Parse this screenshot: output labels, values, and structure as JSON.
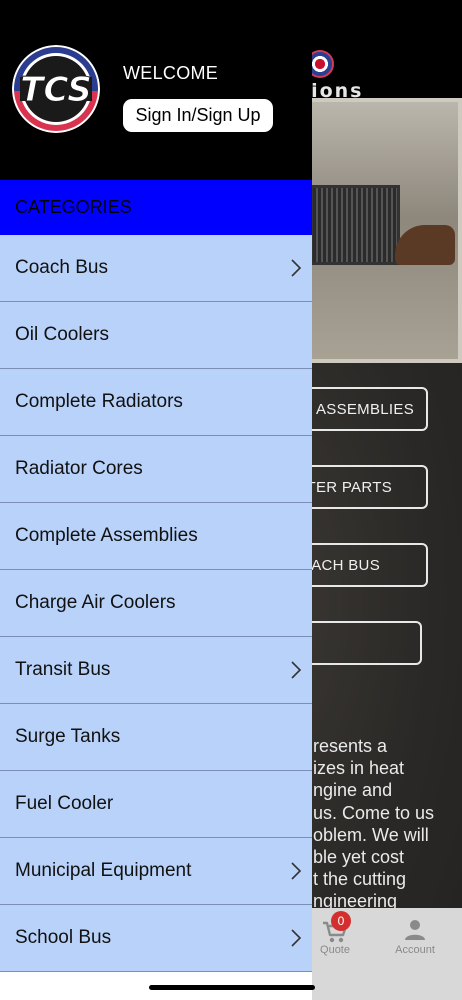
{
  "background": {
    "logo_text": "tions",
    "buttons": [
      "TE ASSEMBLIES",
      "TER PARTS",
      "ACH BUS",
      ""
    ],
    "paragraph_lines": [
      "resents a",
      "izes in heat",
      "ngine and",
      "us. Come to us",
      "oblem. We will",
      "ble yet cost",
      "t the cutting",
      "ngineering"
    ],
    "tabbar": {
      "quote_label": "Quote",
      "quote_badge": "0",
      "account_label": "Account"
    }
  },
  "drawer": {
    "logo_text": "TCS",
    "welcome": "WELCOME",
    "signin_label": "Sign In/Sign Up",
    "categories_title": "CATEGORIES",
    "categories": [
      {
        "label": "Coach Bus",
        "has_submenu": true
      },
      {
        "label": "Oil Coolers",
        "has_submenu": false
      },
      {
        "label": "Complete Radiators",
        "has_submenu": false
      },
      {
        "label": "Radiator Cores",
        "has_submenu": false
      },
      {
        "label": "Complete Assemblies",
        "has_submenu": false
      },
      {
        "label": "Charge Air Coolers",
        "has_submenu": false
      },
      {
        "label": "Transit Bus",
        "has_submenu": true
      },
      {
        "label": "Surge Tanks",
        "has_submenu": false
      },
      {
        "label": "Fuel Cooler",
        "has_submenu": false
      },
      {
        "label": "Municipal Equipment",
        "has_submenu": true
      },
      {
        "label": "School Bus",
        "has_submenu": true
      }
    ]
  },
  "colors": {
    "drawer_header_bg": "#000000",
    "categories_header_bg": "#0000ff",
    "category_item_bg": "#b9d2fa",
    "badge": "#d32f2f"
  },
  "icons": {
    "chevron": "chevron-right-icon",
    "cart": "cart-icon",
    "account": "account-icon"
  }
}
